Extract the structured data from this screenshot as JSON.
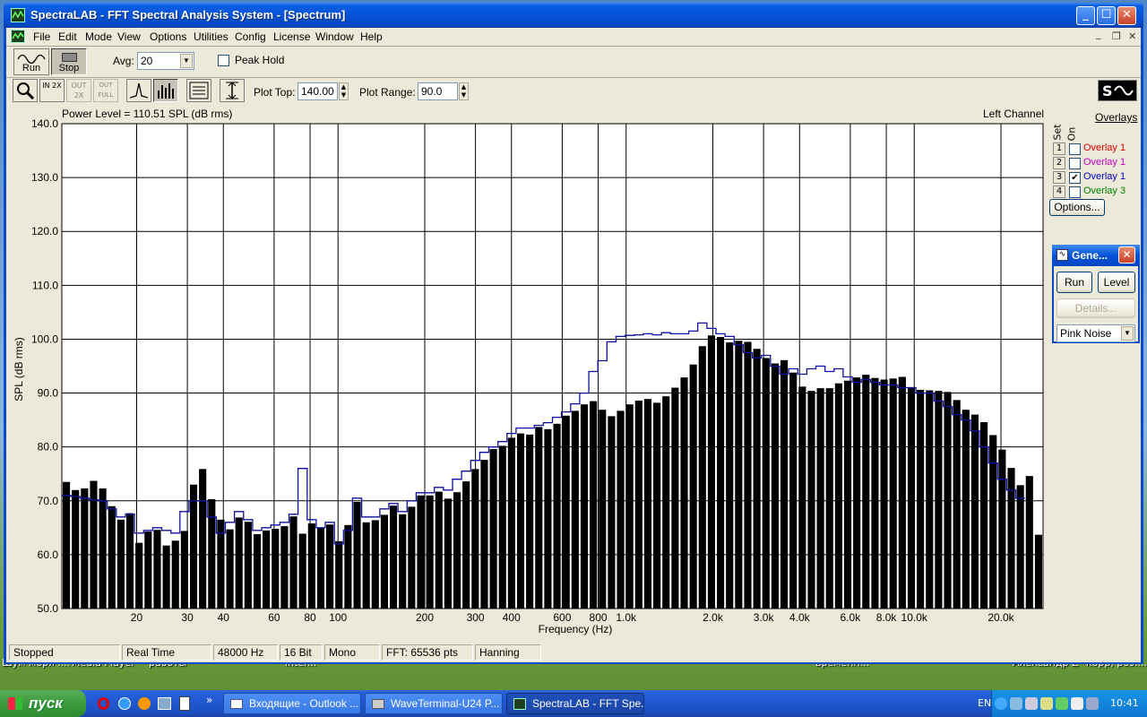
{
  "window": {
    "title": "SpectraLAB - FFT Spectral Analysis System - [Spectrum]",
    "controls": {
      "minimize": "_",
      "maximize": "☐",
      "close": "✕"
    }
  },
  "menu": [
    "File",
    "Edit",
    "Mode",
    "View",
    "Options",
    "Utilities",
    "Config",
    "License",
    "Window",
    "Help"
  ],
  "mdi_controls": {
    "minimize": "_",
    "restore": "❐",
    "close": "✕"
  },
  "toolbar": {
    "run_label": "Run",
    "stop_label": "Stop",
    "avg_label": "Avg:",
    "avg_value": "20",
    "peak_hold_label": "Peak Hold",
    "plot_top_label": "Plot Top:",
    "plot_top_value": "140.00",
    "plot_range_label": "Plot Range:",
    "plot_range_value": "90.0",
    "zoom_in_label": "IN 2X",
    "zoom_out_label": "OUT 2X",
    "zoom_full_label": "OUT FULL"
  },
  "plot": {
    "power_level": "Power Level = 110.51 SPL (dB rms)",
    "channel": "Left Channel",
    "bar_color": "#000000",
    "overlay_color": "#1010a0"
  },
  "chart_data": {
    "type": "bar",
    "ylabel": "SPL (dB rms)",
    "xlabel": "Frequency (Hz)",
    "ylim": [
      50,
      140
    ],
    "xlim": [
      11,
      28000
    ],
    "xscale": "log",
    "grid": true,
    "y_ticks": [
      "50.0",
      "60.0",
      "70.0",
      "80.0",
      "90.0",
      "100.0",
      "110.0",
      "120.0",
      "130.0",
      "140.0"
    ],
    "x_ticks": [
      {
        "v": 20,
        "t": "20"
      },
      {
        "v": 30,
        "t": "30"
      },
      {
        "v": 40,
        "t": "40"
      },
      {
        "v": 60,
        "t": "60"
      },
      {
        "v": 80,
        "t": "80"
      },
      {
        "v": 100,
        "t": "100"
      },
      {
        "v": 200,
        "t": "200"
      },
      {
        "v": 300,
        "t": "300"
      },
      {
        "v": 400,
        "t": "400"
      },
      {
        "v": 600,
        "t": "600"
      },
      {
        "v": 800,
        "t": "800"
      },
      {
        "v": 1000,
        "t": "1.0k"
      },
      {
        "v": 2000,
        "t": "2.0k"
      },
      {
        "v": 3000,
        "t": "3.0k"
      },
      {
        "v": 4000,
        "t": "4.0k"
      },
      {
        "v": 6000,
        "t": "6.0k"
      },
      {
        "v": 8000,
        "t": "8.0k"
      },
      {
        "v": 10000,
        "t": "10.0k"
      },
      {
        "v": 20000,
        "t": "20.0k"
      }
    ],
    "series": [
      {
        "name": "Spectrum",
        "values": [
          73.5,
          72.0,
          72.3,
          73.7,
          72.3,
          69.0,
          66.5,
          67.7,
          62.2,
          64.3,
          64.6,
          61.7,
          62.6,
          64.4,
          73.0,
          75.9,
          70.3,
          66.5,
          64.7,
          66.9,
          66.1,
          63.8,
          64.5,
          64.8,
          65.3,
          67.1,
          63.9,
          65.8,
          64.9,
          65.6,
          62.5,
          65.5,
          69.8,
          66.0,
          66.4,
          67.4,
          69.1,
          67.5,
          68.9,
          71.0,
          71.0,
          71.7,
          70.4,
          71.6,
          73.6,
          75.9,
          77.6,
          79.6,
          80.2,
          81.7,
          82.5,
          82.3,
          83.7,
          83.3,
          84.3,
          85.8,
          86.7,
          87.9,
          88.5,
          86.9,
          85.7,
          86.7,
          87.9,
          88.6,
          88.9,
          88.2,
          89.4,
          91.0,
          92.9,
          95.3,
          98.7,
          100.7,
          100.4,
          99.4,
          99.7,
          99.5,
          98.2,
          96.5,
          95.5,
          96.1,
          93.8,
          91.2,
          90.4,
          90.9,
          90.9,
          91.8,
          92.3,
          92.9,
          93.4,
          92.8,
          92.5,
          92.7,
          93.0,
          91.1,
          90.6,
          90.5,
          90.4,
          90.2,
          88.7,
          86.9,
          86.0,
          84.6,
          82.2,
          79.5,
          76.1,
          72.9,
          74.6,
          63.7
        ]
      },
      {
        "name": "Overlay 1",
        "values": [
          71.0,
          70.8,
          70.5,
          70.2,
          70.0,
          68.5,
          67.0,
          67.5,
          64.0,
          64.5,
          65.0,
          64.5,
          64.0,
          68.0,
          70.0,
          70.0,
          67.0,
          64.0,
          66.0,
          68.0,
          66.5,
          64.5,
          65.0,
          65.5,
          66.0,
          67.5,
          76.0,
          66.5,
          65.0,
          66.0,
          62.0,
          64.5,
          70.5,
          67.0,
          67.0,
          68.5,
          69.5,
          68.0,
          70.0,
          71.5,
          71.5,
          72.5,
          72.0,
          74.0,
          75.5,
          77.5,
          79.0,
          80.0,
          81.0,
          82.5,
          83.5,
          83.5,
          84.0,
          84.5,
          85.5,
          86.5,
          88.0,
          90.0,
          94.0,
          96.0,
          99.5,
          100.5,
          100.7,
          100.8,
          101.0,
          100.8,
          101.2,
          101.0,
          101.0,
          101.5,
          103.0,
          102.0,
          101.0,
          100.5,
          99.0,
          97.5,
          96.5,
          97.0,
          95.0,
          93.5,
          94.5,
          93.5,
          94.5,
          95.0,
          94.0,
          94.5,
          93.0,
          92.0,
          92.5,
          92.0,
          91.5,
          91.5,
          91.0,
          91.0,
          90.0,
          90.0,
          88.5,
          87.5,
          86.0,
          85.0,
          83.0,
          80.0,
          77.0,
          74.0,
          72.0,
          70.5
        ]
      }
    ]
  },
  "overlays": {
    "header": "Overlays",
    "set_label": "Set",
    "on_label": "On",
    "items": [
      {
        "num": "1",
        "label": "Overlay 1",
        "color": "#e00000",
        "checked": false
      },
      {
        "num": "2",
        "label": "Overlay 1",
        "color": "#c000c0",
        "checked": false
      },
      {
        "num": "3",
        "label": "Overlay 1",
        "color": "#0000c0",
        "checked": true
      },
      {
        "num": "4",
        "label": "Overlay 3",
        "color": "#008000",
        "checked": false
      }
    ],
    "options_label": "Options..."
  },
  "generator": {
    "title": "Gene...",
    "run_label": "Run",
    "level_label": "Level",
    "details_label": "Details...",
    "signal": "Pink Noise"
  },
  "status": [
    "Stopped",
    "Real Time",
    "48000 Hz",
    "16 Bit",
    "Mono",
    "FFT: 65536 pts",
    "Hanning"
  ],
  "desktop": [
    {
      "line1": "Шум моря ...."
    },
    {
      "line1": "Media Player"
    },
    {
      "line1": "работы"
    },
    {
      "line1": "Inter..."
    },
    {
      "line1": "временн..."
    },
    {
      "line1": "Александр Z"
    },
    {
      "line1": "корр, роз...."
    }
  ],
  "taskbar": {
    "start": "пуск",
    "tasks": [
      "Входящие - Outlook ...",
      "WaveTerminal-U24 P...",
      "SpectraLAB - FFT Spe..."
    ],
    "lang": "EN",
    "time": "10:41"
  }
}
